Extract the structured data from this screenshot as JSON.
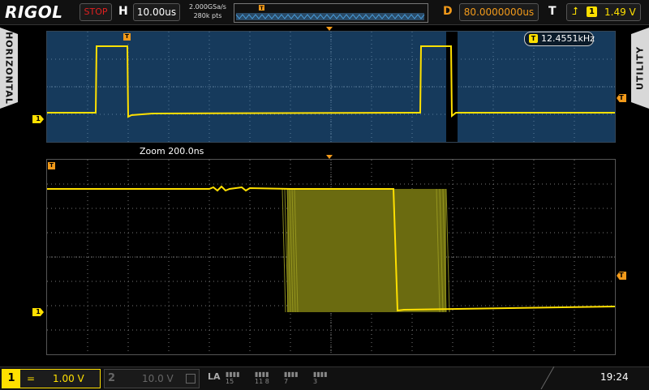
{
  "brand": "RIGOL",
  "header": {
    "run_status": "STOP",
    "h_label": "H",
    "timebase": "10.00us",
    "sample_rate": "2.000GSa/s",
    "memory_depth": "280k pts",
    "d_label": "D",
    "trigger_delay": "80.0000000us",
    "t_label": "T",
    "trigger_source": "1",
    "trigger_level": "1.49 V"
  },
  "side_tabs": {
    "left": "HORIZONTAL",
    "right": "UTILITY"
  },
  "main_view": {
    "frequency_readout": "12.4551kHz"
  },
  "zoom_view": {
    "label": "Zoom  200.0ns"
  },
  "markers": {
    "channel": "1",
    "trigger": "T"
  },
  "footer": {
    "ch1": {
      "number": "1",
      "coupling": "=",
      "scale": "1.00 V"
    },
    "ch2": {
      "number": "2",
      "scale": "10.0 V"
    },
    "la": {
      "label": "LA",
      "groups": [
        [
          "15",
          ""
        ],
        [
          "11",
          "8"
        ],
        [
          "7",
          ""
        ],
        [
          "3",
          ""
        ]
      ]
    },
    "clock": "19:24"
  },
  "colors": {
    "ch1": "#ffe000",
    "trigger": "#f29a1a",
    "stop": "#e02020",
    "main_bg": "#163a5c"
  }
}
